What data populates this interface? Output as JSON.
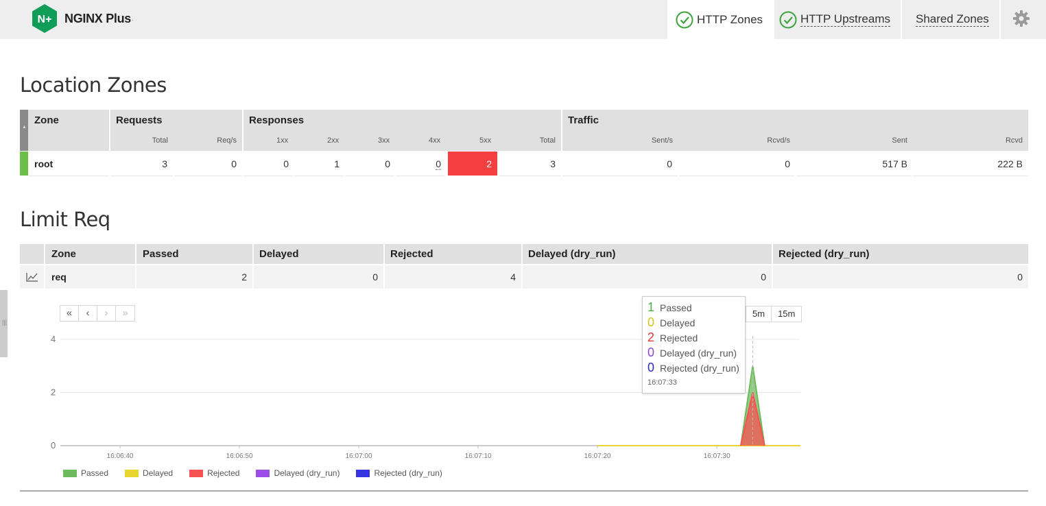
{
  "app": {
    "name": "NGINX Plus",
    "logo_text": "N+"
  },
  "tabs": [
    {
      "label": "HTTP Zones",
      "status": "ok",
      "active": true
    },
    {
      "label": "HTTP Upstreams",
      "status": "ok",
      "active": false
    },
    {
      "label": "Shared Zones",
      "active": false
    }
  ],
  "settings_icon": "gear-icon",
  "location_zones": {
    "title": "Location Zones",
    "groups": {
      "zone": "Zone",
      "requests": "Requests",
      "responses": "Responses",
      "traffic": "Traffic"
    },
    "sub_headers": {
      "total": "Total",
      "req_s": "Req/s",
      "r1xx": "1xx",
      "r2xx": "2xx",
      "r3xx": "3xx",
      "r4xx": "4xx",
      "r5xx": "5xx",
      "resp_total": "Total",
      "sent_s": "Sent/s",
      "rcvd_s": "Rcvd/s",
      "sent": "Sent",
      "rcvd": "Rcvd"
    },
    "row": {
      "zone": "root",
      "total": "3",
      "req_s": "0",
      "r1xx": "0",
      "r2xx": "1",
      "r3xx": "0",
      "r4xx": "0",
      "r5xx": "2",
      "resp_total": "3",
      "sent_s": "0",
      "rcvd_s": "0",
      "sent": "517 B",
      "rcvd": "222 B"
    },
    "status_color": "#6cc04a",
    "alert_color": "#f44040"
  },
  "limit_req": {
    "title": "Limit Req",
    "headers": {
      "zone": "Zone",
      "passed": "Passed",
      "delayed": "Delayed",
      "rejected": "Rejected",
      "delayed_dry": "Delayed (dry_run)",
      "rejected_dry": "Rejected (dry_run)"
    },
    "row": {
      "zone": "req",
      "passed": "2",
      "delayed": "0",
      "rejected": "4",
      "delayed_dry": "0",
      "rejected_dry": "0"
    },
    "chart_icon": "line-chart-icon"
  },
  "pager": {
    "first": "«",
    "prev": "‹",
    "next": "›",
    "last": "»"
  },
  "ranges": [
    "5m",
    "15m"
  ],
  "tooltip": {
    "items": [
      {
        "value": "1",
        "label": "Passed",
        "color": "#4cae4c"
      },
      {
        "value": "0",
        "label": "Delayed",
        "color": "#d4c21a"
      },
      {
        "value": "2",
        "label": "Rejected",
        "color": "#e83535"
      },
      {
        "value": "0",
        "label": "Delayed (dry_run)",
        "color": "#8e44d6"
      },
      {
        "value": "0",
        "label": "Rejected (dry_run)",
        "color": "#2a2ad6"
      }
    ],
    "time": "16:07:33"
  },
  "chart_data": {
    "type": "area",
    "x": [
      "16:06:40",
      "16:06:50",
      "16:07:00",
      "16:07:10",
      "16:07:20",
      "16:07:30"
    ],
    "ylim": [
      0,
      4
    ],
    "yticks": [
      0,
      2,
      4
    ],
    "grid": true,
    "legend_placement": "bottom-left",
    "series": [
      {
        "name": "Passed",
        "color": "#6dbb5c",
        "points": [
          [
            "16:07:20",
            0
          ],
          [
            "16:07:32",
            0
          ],
          [
            "16:07:33",
            3
          ],
          [
            "16:07:34",
            0
          ],
          [
            "16:07:37",
            0
          ]
        ]
      },
      {
        "name": "Delayed",
        "color": "#e8d52e",
        "points": [
          [
            "16:07:20",
            0
          ],
          [
            "16:07:37",
            0
          ]
        ]
      },
      {
        "name": "Rejected",
        "color": "#f75252",
        "points": [
          [
            "16:07:32",
            0
          ],
          [
            "16:07:33",
            2
          ],
          [
            "16:07:34",
            0
          ]
        ]
      },
      {
        "name": "Delayed (dry_run)",
        "color": "#9c4de8",
        "points": []
      },
      {
        "name": "Rejected (dry_run)",
        "color": "#3636e0",
        "points": []
      }
    ]
  }
}
